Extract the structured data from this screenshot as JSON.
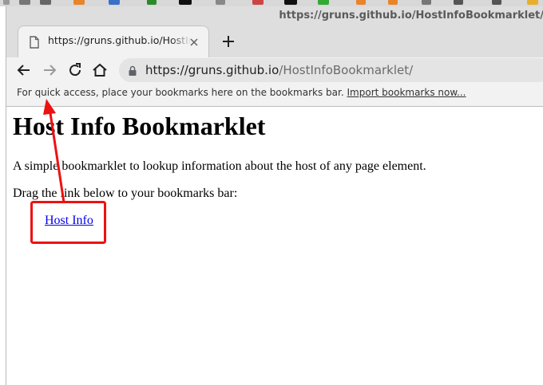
{
  "window": {
    "title": "https://gruns.github.io/HostInfoBookmarklet/"
  },
  "tab": {
    "title": "https://gruns.github.io/HostInfoBookmarklet/",
    "icon": "document-icon"
  },
  "toolbar": {
    "url_host": "https://gruns.github.io",
    "url_path": "/HostInfoBookmarklet/"
  },
  "bookmarks_bar": {
    "message": "For quick access, place your bookmarks here on the bookmarks bar.",
    "import_link": "Import bookmarks now..."
  },
  "page": {
    "heading": "Host Info Bookmarklet",
    "description": "A simple bookmarklet to lookup information about the host of any page element.",
    "instruction": "Drag the link below to your bookmarks bar:",
    "bookmarklet_link": "Host Info"
  },
  "colors": {
    "annotation": "#ff0000",
    "link": "#0000ee",
    "chrome_bg": "#f2f2f2",
    "titlebar_bg": "#dedede"
  }
}
